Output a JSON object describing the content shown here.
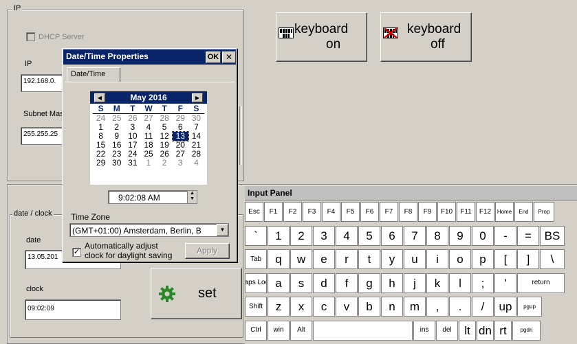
{
  "ip_group": {
    "legend": "IP",
    "dhcp_label": "DHCP Server",
    "ip_label": "IP",
    "ip_value": "192.168.0.",
    "subnet_label": "Subnet Mas",
    "subnet_value": "255.255.25"
  },
  "keyboard_buttons": {
    "on_line1": "keyboard",
    "on_line2": "on",
    "off_line1": "keyboard",
    "off_line2": "off",
    "icon_text": "QWE SD"
  },
  "clock_group": {
    "legend": "date / clock",
    "date_label": "date",
    "date_value": "13.05.201",
    "clock_label": "clock",
    "clock_value": "09:02:09",
    "set_label": "set"
  },
  "dialog": {
    "title": "Date/Time Properties",
    "ok_label": "OK",
    "close_label": "✕",
    "tab_label": "Date/Time",
    "calendar": {
      "month_label": "May 2016",
      "prev": "◀",
      "next": "▶",
      "days_of_week": [
        "S",
        "M",
        "T",
        "W",
        "T",
        "F",
        "S"
      ],
      "weeks": [
        [
          [
            "24",
            "other"
          ],
          [
            "25",
            "other"
          ],
          [
            "26",
            "other"
          ],
          [
            "27",
            "other"
          ],
          [
            "28",
            "other"
          ],
          [
            "29",
            "other"
          ],
          [
            "30",
            "other"
          ]
        ],
        [
          [
            "1",
            ""
          ],
          [
            "2",
            ""
          ],
          [
            "3",
            ""
          ],
          [
            "4",
            ""
          ],
          [
            "5",
            ""
          ],
          [
            "6",
            ""
          ],
          [
            "7",
            ""
          ]
        ],
        [
          [
            "8",
            ""
          ],
          [
            "9",
            ""
          ],
          [
            "10",
            ""
          ],
          [
            "11",
            ""
          ],
          [
            "12",
            ""
          ],
          [
            "13",
            "sel"
          ],
          [
            "14",
            ""
          ]
        ],
        [
          [
            "15",
            ""
          ],
          [
            "16",
            ""
          ],
          [
            "17",
            ""
          ],
          [
            "18",
            ""
          ],
          [
            "19",
            ""
          ],
          [
            "20",
            ""
          ],
          [
            "21",
            ""
          ]
        ],
        [
          [
            "22",
            ""
          ],
          [
            "23",
            ""
          ],
          [
            "24",
            ""
          ],
          [
            "25",
            ""
          ],
          [
            "26",
            ""
          ],
          [
            "27",
            ""
          ],
          [
            "28",
            ""
          ]
        ],
        [
          [
            "29",
            ""
          ],
          [
            "30",
            ""
          ],
          [
            "31",
            ""
          ],
          [
            "1",
            "other"
          ],
          [
            "2",
            "other"
          ],
          [
            "3",
            "other"
          ],
          [
            "4",
            "other"
          ]
        ]
      ]
    },
    "time_value": "9:02:08 AM",
    "timezone_label": "Time Zone",
    "timezone_value": "(GMT+01:00) Amsterdam, Berlin, B",
    "dst_label_line1": "Automatically adjust",
    "dst_label_line2": "clock for daylight saving",
    "dst_checked": true,
    "apply_label": "Apply"
  },
  "input_panel": {
    "title": "Input Panel",
    "rows": [
      [
        "Esc",
        "F1",
        "F2",
        "F3",
        "F4",
        "F5",
        "F6",
        "F7",
        "F8",
        "F9",
        "F10",
        "F11",
        "F12",
        "Home",
        "End",
        "Prop"
      ],
      [
        "`",
        "1",
        "2",
        "3",
        "4",
        "5",
        "6",
        "7",
        "8",
        "9",
        "0",
        "-",
        "=",
        "BS"
      ],
      [
        "Tab",
        "q",
        "w",
        "e",
        "r",
        "t",
        "y",
        "u",
        "i",
        "o",
        "p",
        "[",
        "]",
        "\\"
      ],
      [
        "Caps Lock",
        "a",
        "s",
        "d",
        "f",
        "g",
        "h",
        "j",
        "k",
        "l",
        ";",
        "'",
        "return"
      ],
      [
        "Shift",
        "z",
        "x",
        "c",
        "v",
        "b",
        "n",
        "m",
        ",",
        ".",
        "/",
        "up",
        "pgup"
      ],
      [
        "Ctrl",
        "win",
        "Alt",
        "",
        "ins",
        "del",
        "lt",
        "dn",
        "rt",
        "pgdn"
      ]
    ]
  }
}
